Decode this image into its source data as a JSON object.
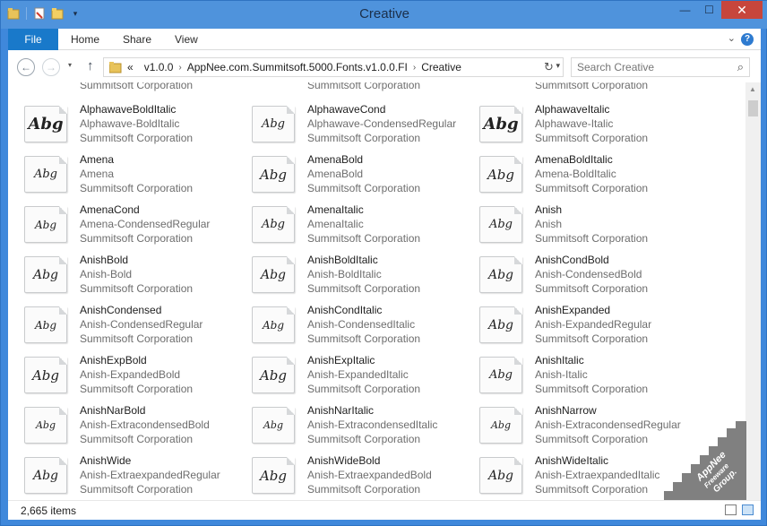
{
  "window": {
    "title": "Creative"
  },
  "titlebar_buttons": [
    "minimize",
    "maximize",
    "close"
  ],
  "ribbon": {
    "tabs": [
      "File",
      "Home",
      "Share",
      "View"
    ],
    "help": "?"
  },
  "nav": {
    "crumbs": [
      "v1.0.0",
      "AppNee.com.Summitsoft.5000.Fonts.v1.0.0.FI",
      "Creative"
    ],
    "overflow": "«",
    "search_placeholder": "Search Creative"
  },
  "top_partial": [
    "Summitsoft Corporation",
    "Summitsoft Corporation",
    "Summitsoft Corporation"
  ],
  "items": [
    {
      "name": "AlphawaveBoldItalic",
      "sub": "Alphawave-BoldItalic",
      "vendor": "Summitsoft Corporation",
      "preview": "Abg"
    },
    {
      "name": "AlphawaveCond",
      "sub": "Alphawave-CondensedRegular",
      "vendor": "Summitsoft Corporation",
      "preview": "Abg"
    },
    {
      "name": "AlphawaveItalic",
      "sub": "Alphawave-Italic",
      "vendor": "Summitsoft Corporation",
      "preview": "Abg"
    },
    {
      "name": "Amena",
      "sub": "Amena",
      "vendor": "Summitsoft Corporation",
      "preview": "Abg"
    },
    {
      "name": "AmenaBold",
      "sub": "AmenaBold",
      "vendor": "Summitsoft Corporation",
      "preview": "Abg"
    },
    {
      "name": "AmenaBoldItalic",
      "sub": "Amena-BoldItalic",
      "vendor": "Summitsoft Corporation",
      "preview": "Abg"
    },
    {
      "name": "AmenaCond",
      "sub": "Amena-CondensedRegular",
      "vendor": "Summitsoft Corporation",
      "preview": "Abg"
    },
    {
      "name": "AmenaItalic",
      "sub": "AmenaItalic",
      "vendor": "Summitsoft Corporation",
      "preview": "Abg"
    },
    {
      "name": "Anish",
      "sub": "Anish",
      "vendor": "Summitsoft Corporation",
      "preview": "Abg"
    },
    {
      "name": "AnishBold",
      "sub": "Anish-Bold",
      "vendor": "Summitsoft Corporation",
      "preview": "Abg"
    },
    {
      "name": "AnishBoldItalic",
      "sub": "Anish-BoldItalic",
      "vendor": "Summitsoft Corporation",
      "preview": "Abg"
    },
    {
      "name": "AnishCondBold",
      "sub": "Anish-CondensedBold",
      "vendor": "Summitsoft Corporation",
      "preview": "Abg"
    },
    {
      "name": "AnishCondensed",
      "sub": "Anish-CondensedRegular",
      "vendor": "Summitsoft Corporation",
      "preview": "Abg"
    },
    {
      "name": "AnishCondItalic",
      "sub": "Anish-CondensedItalic",
      "vendor": "Summitsoft Corporation",
      "preview": "Abg"
    },
    {
      "name": "AnishExpanded",
      "sub": "Anish-ExpandedRegular",
      "vendor": "Summitsoft Corporation",
      "preview": "Abg"
    },
    {
      "name": "AnishExpBold",
      "sub": "Anish-ExpandedBold",
      "vendor": "Summitsoft Corporation",
      "preview": "Abg"
    },
    {
      "name": "AnishExpItalic",
      "sub": "Anish-ExpandedItalic",
      "vendor": "Summitsoft Corporation",
      "preview": "Abg"
    },
    {
      "name": "AnishItalic",
      "sub": "Anish-Italic",
      "vendor": "Summitsoft Corporation",
      "preview": "Abg"
    },
    {
      "name": "AnishNarBold",
      "sub": "Anish-ExtracondensedBold",
      "vendor": "Summitsoft Corporation",
      "preview": "Abg"
    },
    {
      "name": "AnishNarItalic",
      "sub": "Anish-ExtracondensedItalic",
      "vendor": "Summitsoft Corporation",
      "preview": "Abg"
    },
    {
      "name": "AnishNarrow",
      "sub": "Anish-ExtracondensedRegular",
      "vendor": "Summitsoft Corporation",
      "preview": "Abg"
    },
    {
      "name": "AnishWide",
      "sub": "Anish-ExtraexpandedRegular",
      "vendor": "Summitsoft Corporation",
      "preview": "Abg"
    },
    {
      "name": "AnishWideBold",
      "sub": "Anish-ExtraexpandedBold",
      "vendor": "Summitsoft Corporation",
      "preview": "Abg"
    },
    {
      "name": "AnishWideItalic",
      "sub": "Anish-ExtraexpandedItalic",
      "vendor": "Summitsoft Corporation",
      "preview": "Abg"
    }
  ],
  "status": {
    "count": "2,665 items"
  },
  "watermark": {
    "lines": [
      "AppNee",
      "Freeware",
      "Group."
    ]
  },
  "colors": {
    "titlebar": "#4f93dc",
    "file_tab": "#1979ca",
    "close": "#c7463c"
  }
}
